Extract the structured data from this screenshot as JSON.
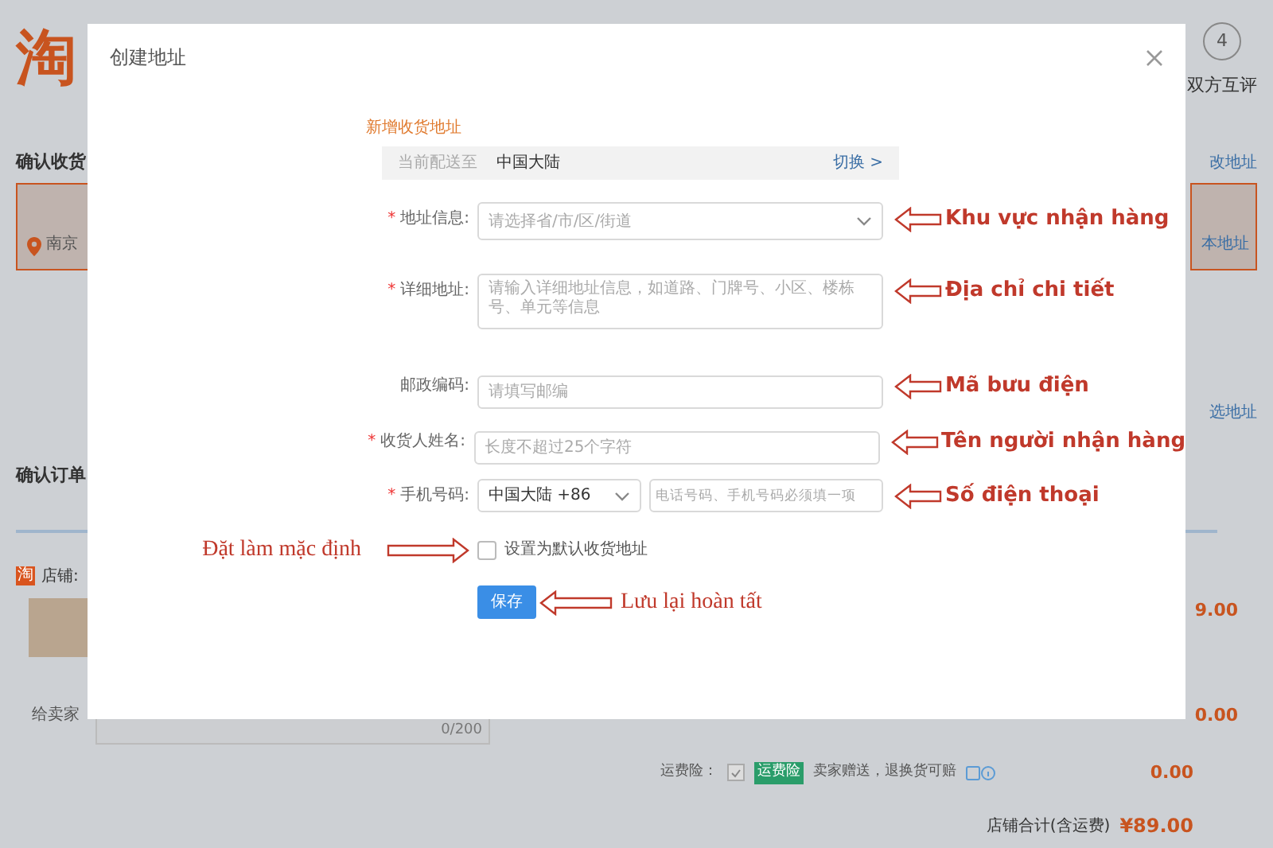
{
  "background_page": {
    "logo": "淘",
    "step": {
      "number": "4",
      "label": "双方互评"
    },
    "address_heading": "确认收货",
    "address_link": "改地址",
    "address_card": {
      "text": "南京"
    },
    "right_card": {
      "text": "本地址"
    },
    "manage_link": "选地址",
    "order_heading": "确认订单",
    "store_icon": "淘",
    "store_label": "店铺:",
    "message_label": "给卖家",
    "message_counter": "0/200",
    "item_price": "9.00",
    "shipping_price": "0.00",
    "insurance": {
      "label": "运费险：",
      "checked": true,
      "tag": "运费险",
      "text": "卖家赠送，退换货可赔",
      "price": "0.00"
    },
    "store_total": {
      "label": "店铺合计(含运费)",
      "value": "¥89.00"
    }
  },
  "dialog": {
    "title": "创建地址",
    "section_title": "新增收货地址",
    "region_bar": {
      "label": "当前配送至",
      "value": "中国大陆",
      "link": "切换 >"
    },
    "fields": [
      {
        "kind": "select",
        "label": "地址信息:",
        "required_mark": "*",
        "placeholder": "请选择省/市/区/街道",
        "annotation": "Khu vực nhận hàng"
      },
      {
        "kind": "textarea",
        "label": "详细地址:",
        "required_mark": "*",
        "placeholder": "请输入详细地址信息，如道路、门牌号、小区、楼栋号、单元等信息",
        "annotation": "Địa chỉ chi tiết"
      },
      {
        "kind": "input",
        "label": "邮政编码:",
        "placeholder": "请填写邮编",
        "annotation": "Mã bưu điện"
      },
      {
        "kind": "input",
        "label": "收货人姓名:",
        "required_mark": "*",
        "placeholder": "长度不超过25个字符",
        "annotation": "Tên người nhận hàng"
      },
      {
        "kind": "phone",
        "label": "手机号码:",
        "required_mark": "*",
        "country": "中国大陆 +86",
        "placeholder": "电话号码、手机号码必须填一项",
        "annotation": "Số điện thoại"
      }
    ],
    "default_checkbox": {
      "label": "设置为默认收货地址",
      "checked": false,
      "annotation": "Đặt làm mặc định"
    },
    "save_button": {
      "label": "保存",
      "annotation": "Lưu lại hoàn tất"
    }
  }
}
